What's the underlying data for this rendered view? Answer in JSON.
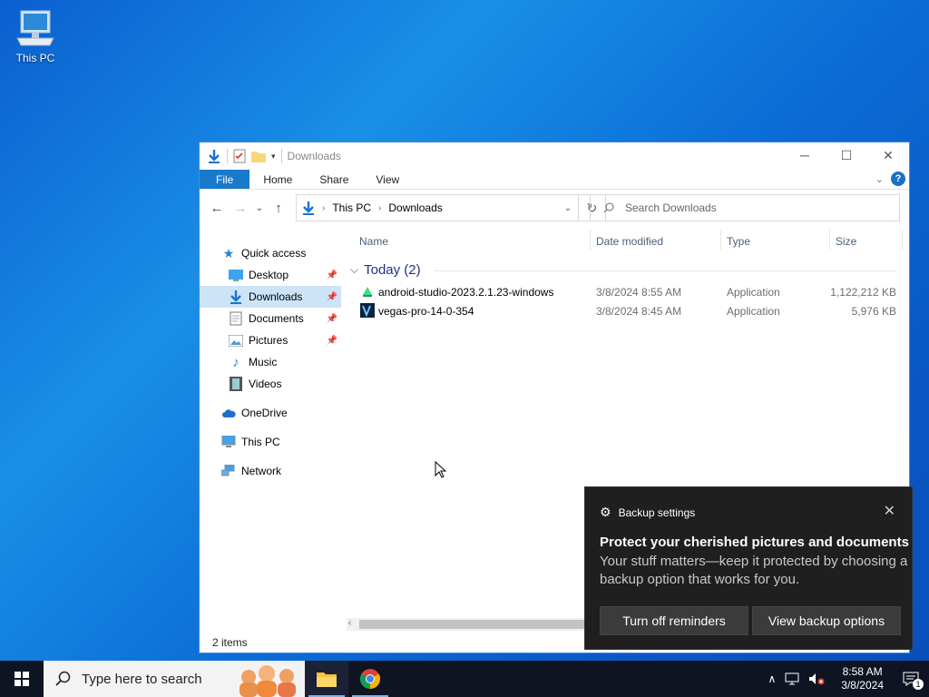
{
  "desktop": {
    "icon_label": "This PC"
  },
  "window": {
    "title": "Downloads",
    "ribbon_tabs": [
      "File",
      "Home",
      "Share",
      "View"
    ],
    "breadcrumbs": [
      "This PC",
      "Downloads"
    ],
    "search_placeholder": "Search Downloads",
    "status": "2 items"
  },
  "nav": {
    "quick_access": "Quick access",
    "items": [
      {
        "label": "Desktop"
      },
      {
        "label": "Downloads"
      },
      {
        "label": "Documents"
      },
      {
        "label": "Pictures"
      },
      {
        "label": "Music"
      },
      {
        "label": "Videos"
      }
    ],
    "onedrive": "OneDrive",
    "this_pc": "This PC",
    "network": "Network"
  },
  "columns": {
    "name": "Name",
    "date": "Date modified",
    "type": "Type",
    "size": "Size"
  },
  "group": {
    "label": "Today (2)"
  },
  "files": [
    {
      "name": "android-studio-2023.2.1.23-windows",
      "date": "3/8/2024 8:55 AM",
      "type": "Application",
      "size": "1,122,212 KB"
    },
    {
      "name": "vegas-pro-14-0-354",
      "date": "3/8/2024 8:45 AM",
      "type": "Application",
      "size": "5,976 KB"
    }
  ],
  "toast": {
    "app": "Backup settings",
    "title": "Protect your cherished pictures and documents",
    "message": "Your stuff matters—keep it protected by choosing a backup option that works for you.",
    "btn_off": "Turn off reminders",
    "btn_view": "View backup options"
  },
  "taskbar": {
    "search_placeholder": "Type here to search",
    "time": "8:58 AM",
    "date": "3/8/2024",
    "notification_count": "1"
  },
  "colors": {
    "accent": "#1979ca",
    "taskbar": "#0f1422",
    "toast_bg": "#1f1f1f"
  }
}
